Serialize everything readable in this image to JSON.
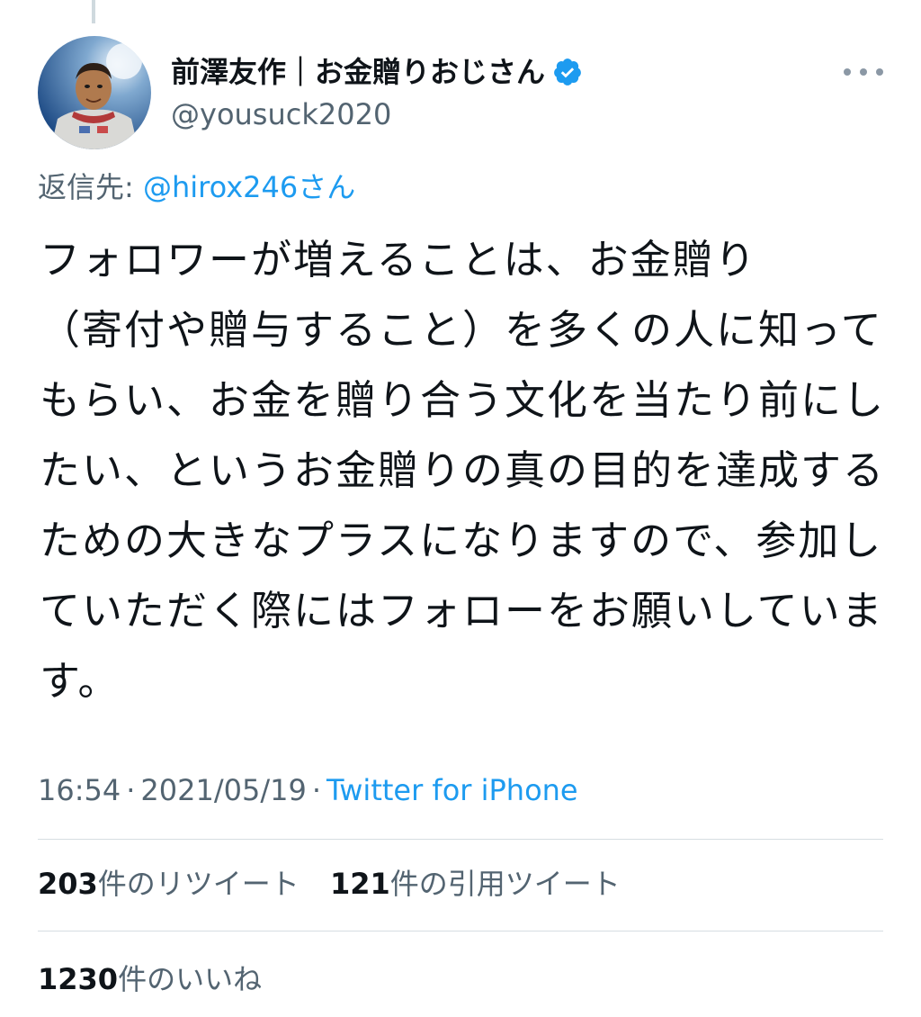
{
  "tweet": {
    "author": {
      "display_name": "前澤友作｜お金贈りおじさん",
      "handle": "@yousuck2020",
      "verified_icon": "verified-badge-icon",
      "avatar_icon": "avatar-illustration"
    },
    "reply_to": {
      "prefix": "返信先:",
      "mention": "@hirox246さん"
    },
    "text": "フォロワーが増えることは、お金贈り\n（寄付や贈与すること）を多くの人に知ってもらい、お金を贈り合う文化を当たり前にしたい、というお金贈りの真の目的を達成するための大きなプラスになりますので、参加していただく際にはフォローをお願いしています。",
    "time": "16:54",
    "date": "2021/05/19",
    "source": "Twitter for iPhone",
    "separator": "·",
    "stats": {
      "retweets": {
        "count": "203",
        "label": "件のリツイート"
      },
      "quotes": {
        "count": "121",
        "label": "件の引用ツイート"
      },
      "likes": {
        "count": "1230",
        "label": "件のいいね"
      }
    }
  },
  "colors": {
    "link": "#1d9bf0",
    "secondary_text": "#536471",
    "primary_text": "#0f1419"
  },
  "more_icon": "more-options-icon"
}
